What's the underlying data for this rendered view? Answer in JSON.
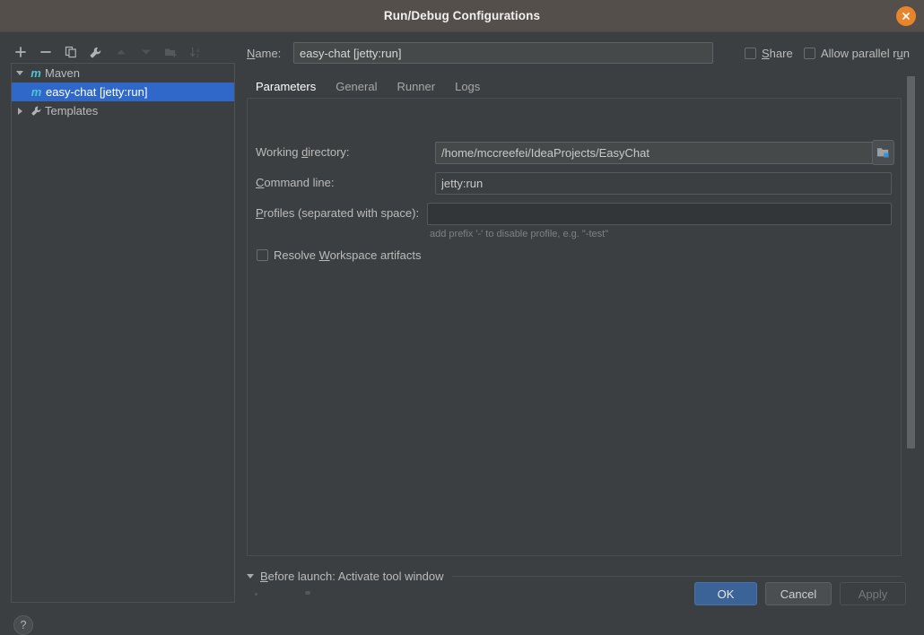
{
  "window": {
    "title": "Run/Debug Configurations",
    "close_icon": "close-icon",
    "accent_orange": "#e8852b",
    "selection_blue": "#2f68c8",
    "tab_accent": "#4a88c7",
    "bg": "#3c3f41",
    "titlebar_bg": "#554f4b"
  },
  "tree_toolbar": {
    "buttons": [
      {
        "name": "add-configuration-button",
        "icon": "plus-icon",
        "enabled": true
      },
      {
        "name": "remove-configuration-button",
        "icon": "minus-icon",
        "enabled": true
      },
      {
        "name": "copy-configuration-button",
        "icon": "copy-icon",
        "enabled": true
      },
      {
        "name": "edit-templates-button",
        "icon": "wrench-icon",
        "enabled": true
      },
      {
        "name": "move-up-button",
        "icon": "arrow-up-icon",
        "enabled": false
      },
      {
        "name": "move-down-button",
        "icon": "arrow-down-icon",
        "enabled": false
      },
      {
        "name": "new-folder-button",
        "icon": "folder-add-icon",
        "enabled": false
      },
      {
        "name": "sort-alphabetically-button",
        "icon": "sort-az-icon",
        "enabled": false
      }
    ]
  },
  "tree": {
    "items": [
      {
        "label": "Maven",
        "icon": "maven-m-icon",
        "level": 1,
        "expanded": true,
        "selected": false,
        "has_twisty": true
      },
      {
        "label": "easy-chat [jetty:run]",
        "icon": "maven-m-icon",
        "level": 2,
        "expanded": false,
        "selected": true,
        "has_twisty": false
      },
      {
        "label": "Templates",
        "icon": "wrench-icon",
        "level": 1,
        "expanded": false,
        "selected": false,
        "has_twisty": true
      }
    ]
  },
  "help": {
    "label": "?",
    "name": "help-button"
  },
  "name_row": {
    "label": "Name:",
    "label_mnemonic": "N",
    "value": "easy-chat [jetty:run]",
    "placeholder": ""
  },
  "options": {
    "share": {
      "label": "Share",
      "mnemonic": "S",
      "checked": false
    },
    "parallel": {
      "label": "Allow parallel run",
      "mnemonic": "u",
      "checked": false
    }
  },
  "tabs": [
    {
      "label": "Parameters",
      "active": true
    },
    {
      "label": "General",
      "active": false
    },
    {
      "label": "Runner",
      "active": false
    },
    {
      "label": "Logs",
      "active": false
    }
  ],
  "parameters": {
    "working_directory": {
      "label": "Working directory:",
      "value": "/home/mccreefei/IdeaProjects/EasyChat",
      "placeholder": "",
      "browse_icon": "folder-open-icon",
      "macro_icon": "folder-macro-icon"
    },
    "command_line": {
      "label": "Command line:",
      "value": "jetty:run",
      "placeholder": ""
    },
    "profiles": {
      "label": "Profiles (separated with space):",
      "value": "",
      "placeholder": "",
      "hint": "add prefix '-' to disable profile, e.g. \"-test\""
    },
    "resolve_workspace": {
      "label": "Resolve Workspace artifacts",
      "mnemonic": "W",
      "checked": false
    }
  },
  "before_launch": {
    "label": "Before launch: Activate tool window",
    "mnemonic": "B",
    "expanded": true
  },
  "buttons": {
    "ok": {
      "label": "OK",
      "enabled": true
    },
    "cancel": {
      "label": "Cancel",
      "enabled": true
    },
    "apply": {
      "label": "Apply",
      "enabled": false
    }
  }
}
